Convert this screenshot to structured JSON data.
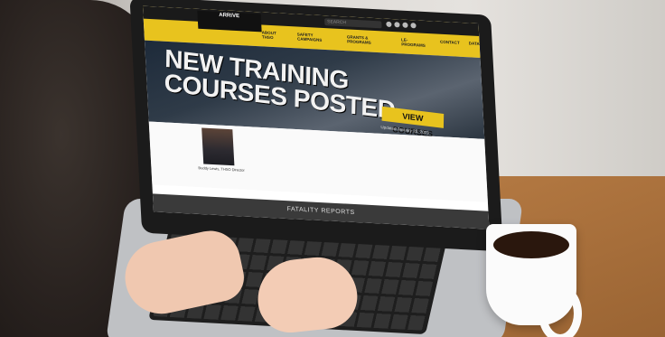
{
  "site": {
    "logo_text": "ARRIVE",
    "search_placeholder": "SEARCH",
    "nav": [
      "ABOUT THSO",
      "SAFETY CAMPAIGNS",
      "GRANTS & PROGRAMS",
      "LE-PROGRAMS",
      "CONTACT",
      "DATA"
    ],
    "hero_title_line1": "NEW TRAINING",
    "hero_title_line2": "COURSES POSTED",
    "cta_label": "VIEW COURSES",
    "cta_sub": "Updated January 20, 2023",
    "photo_caption": "Buddy Lewis, THSO Director",
    "footer_label": "FATALITY REPORTS"
  },
  "colors": {
    "brand_yellow": "#e8c31e",
    "header_dark": "#1a1a1a"
  }
}
